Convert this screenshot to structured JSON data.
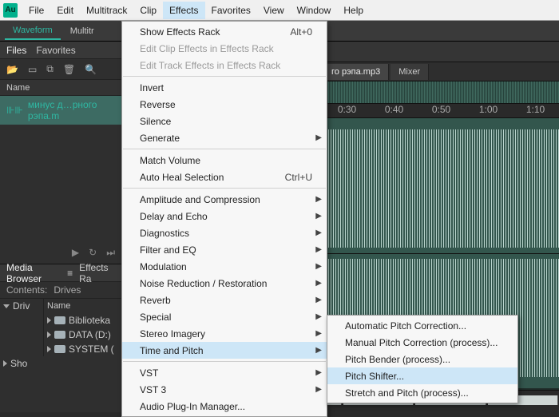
{
  "menubar": {
    "items": [
      "File",
      "Edit",
      "Multitrack",
      "Clip",
      "Effects",
      "Favorites",
      "View",
      "Window",
      "Help"
    ],
    "open_index": 4
  },
  "workspace_tabs": {
    "items": [
      "Waveform",
      "Multitr"
    ],
    "active_index": 0
  },
  "files_panel": {
    "tabs": [
      "Files",
      "Favorites"
    ],
    "header": "Name",
    "rows": [
      {
        "label": "минус д…рного рэпа.m"
      }
    ]
  },
  "media_browser": {
    "tabs": [
      "Media Browser",
      "Effects Ra"
    ],
    "contents_label": "Contents:",
    "drives_label": "Drives",
    "left_header": "Driv",
    "right_header": "Name",
    "rows": [
      {
        "label": "Biblioteka"
      },
      {
        "label": "DATA (D:)"
      },
      {
        "label": "SYSTEM ("
      }
    ],
    "more": "Sho"
  },
  "editor": {
    "file_tabs": [
      {
        "label": "го рэпа.mp3",
        "active": true
      },
      {
        "label": "Mixer",
        "active": false
      }
    ],
    "ruler": [
      "0:30",
      "0:40",
      "0:50",
      "1:00",
      "1:10"
    ]
  },
  "effects_menu": {
    "items": [
      {
        "label": "Show Effects Rack",
        "shortcut": "Alt+0"
      },
      {
        "label": "Edit Clip Effects in Effects Rack",
        "disabled": true
      },
      {
        "label": "Edit Track Effects in Effects Rack",
        "disabled": true
      },
      {
        "sep": true
      },
      {
        "label": "Invert"
      },
      {
        "label": "Reverse"
      },
      {
        "label": "Silence"
      },
      {
        "label": "Generate",
        "submenu": true
      },
      {
        "sep": true
      },
      {
        "label": "Match Volume"
      },
      {
        "label": "Auto Heal Selection",
        "shortcut": "Ctrl+U"
      },
      {
        "sep": true
      },
      {
        "label": "Amplitude and Compression",
        "submenu": true
      },
      {
        "label": "Delay and Echo",
        "submenu": true
      },
      {
        "label": "Diagnostics",
        "submenu": true
      },
      {
        "label": "Filter and EQ",
        "submenu": true
      },
      {
        "label": "Modulation",
        "submenu": true
      },
      {
        "label": "Noise Reduction / Restoration",
        "submenu": true
      },
      {
        "label": "Reverb",
        "submenu": true
      },
      {
        "label": "Special",
        "submenu": true
      },
      {
        "label": "Stereo Imagery",
        "submenu": true
      },
      {
        "label": "Time and Pitch",
        "submenu": true,
        "highlight": true
      },
      {
        "sep": true
      },
      {
        "label": "VST",
        "submenu": true
      },
      {
        "label": "VST 3",
        "submenu": true
      },
      {
        "label": "Audio Plug-In Manager..."
      }
    ]
  },
  "time_pitch_submenu": {
    "items": [
      {
        "label": "Automatic Pitch Correction..."
      },
      {
        "label": "Manual Pitch Correction (process)..."
      },
      {
        "label": "Pitch Bender (process)..."
      },
      {
        "label": "Pitch Shifter...",
        "highlight": true
      },
      {
        "label": "Stretch and Pitch (process)..."
      }
    ]
  }
}
